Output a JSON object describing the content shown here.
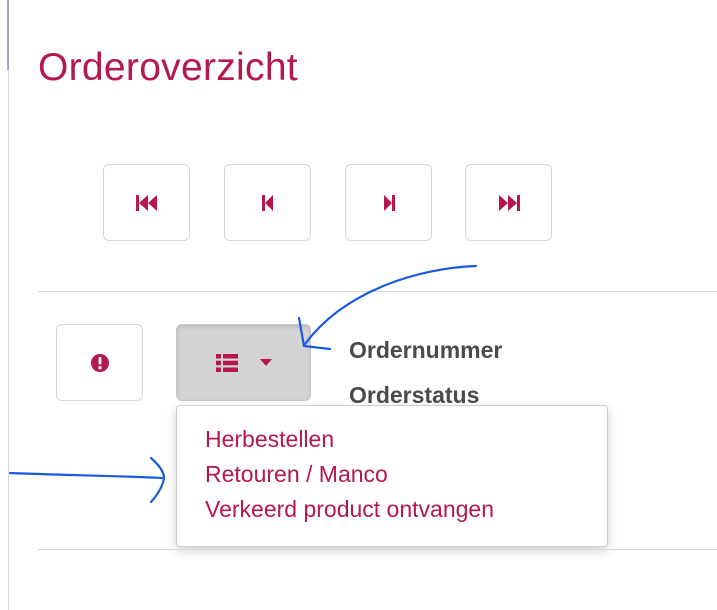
{
  "page": {
    "title": "Orderoverzicht"
  },
  "pager": {
    "buttons": [
      {
        "icon": "first-page-icon"
      },
      {
        "icon": "previous-page-icon"
      },
      {
        "icon": "next-page-icon"
      },
      {
        "icon": "last-page-icon"
      }
    ]
  },
  "toolbar": {
    "info_icon": "info-circle-icon",
    "menu_icon": "list-icon",
    "menu_caret_icon": "caret-down-icon"
  },
  "order": {
    "number_label": "Ordernummer",
    "status_label": "Orderstatus"
  },
  "dropdown": {
    "items": [
      {
        "label": "Herbestellen"
      },
      {
        "label": "Retouren / Manco"
      },
      {
        "label": "Verkeerd product ontvangen"
      }
    ]
  },
  "colors": {
    "accent": "#b5174e",
    "text": "#4a4a4a",
    "annotation": "#1a5ae0"
  }
}
